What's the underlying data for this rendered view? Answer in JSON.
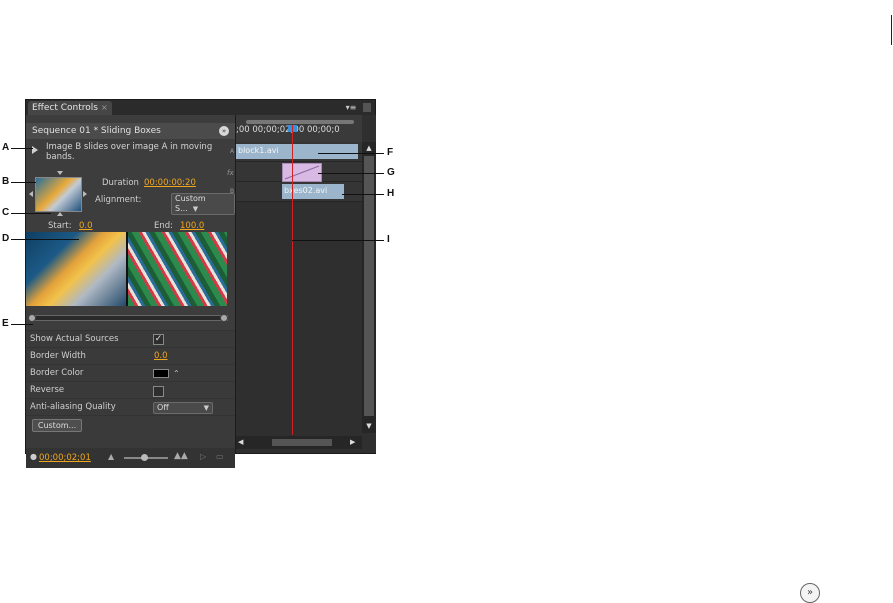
{
  "panel": {
    "tab_label": "Effect Controls",
    "tab_close": "×",
    "panel_menu": "▾≡",
    "sequence_title": "Sequence 01 * Sliding Boxes",
    "description": "Image B slides over image A in moving bands.",
    "duration_label": "Duration",
    "duration_value": "00:00:00:20",
    "alignment_label": "Alignment:",
    "alignment_value": "Custom S...",
    "start_label": "Start:",
    "start_value": "0.0",
    "end_label": "End:",
    "end_value": "100.0",
    "properties": [
      {
        "label": "Show Actual Sources"
      },
      {
        "label": "Border Width",
        "value": "0.0"
      },
      {
        "label": "Border Color"
      },
      {
        "label": "Reverse"
      },
      {
        "label": "Anti-aliasing Quality",
        "value": "Off"
      }
    ],
    "custom_button": "Custom...",
    "current_time": "00;00;02;01",
    "track_labels": [
      "A",
      "fx",
      "B"
    ]
  },
  "timeline": {
    "ruler_text": ";00      00;00;02;00     00;00;0",
    "clip_a": "block1.avi",
    "clip_b": "bxes02.avi"
  },
  "callouts": [
    "A",
    "B",
    "C",
    "D",
    "E",
    "F",
    "G",
    "H",
    "I"
  ],
  "colors": {
    "value_accent": "#f0a720",
    "playhead": "#d02020",
    "clip": "#9bb6cc",
    "transition": "#d7b9e3"
  }
}
